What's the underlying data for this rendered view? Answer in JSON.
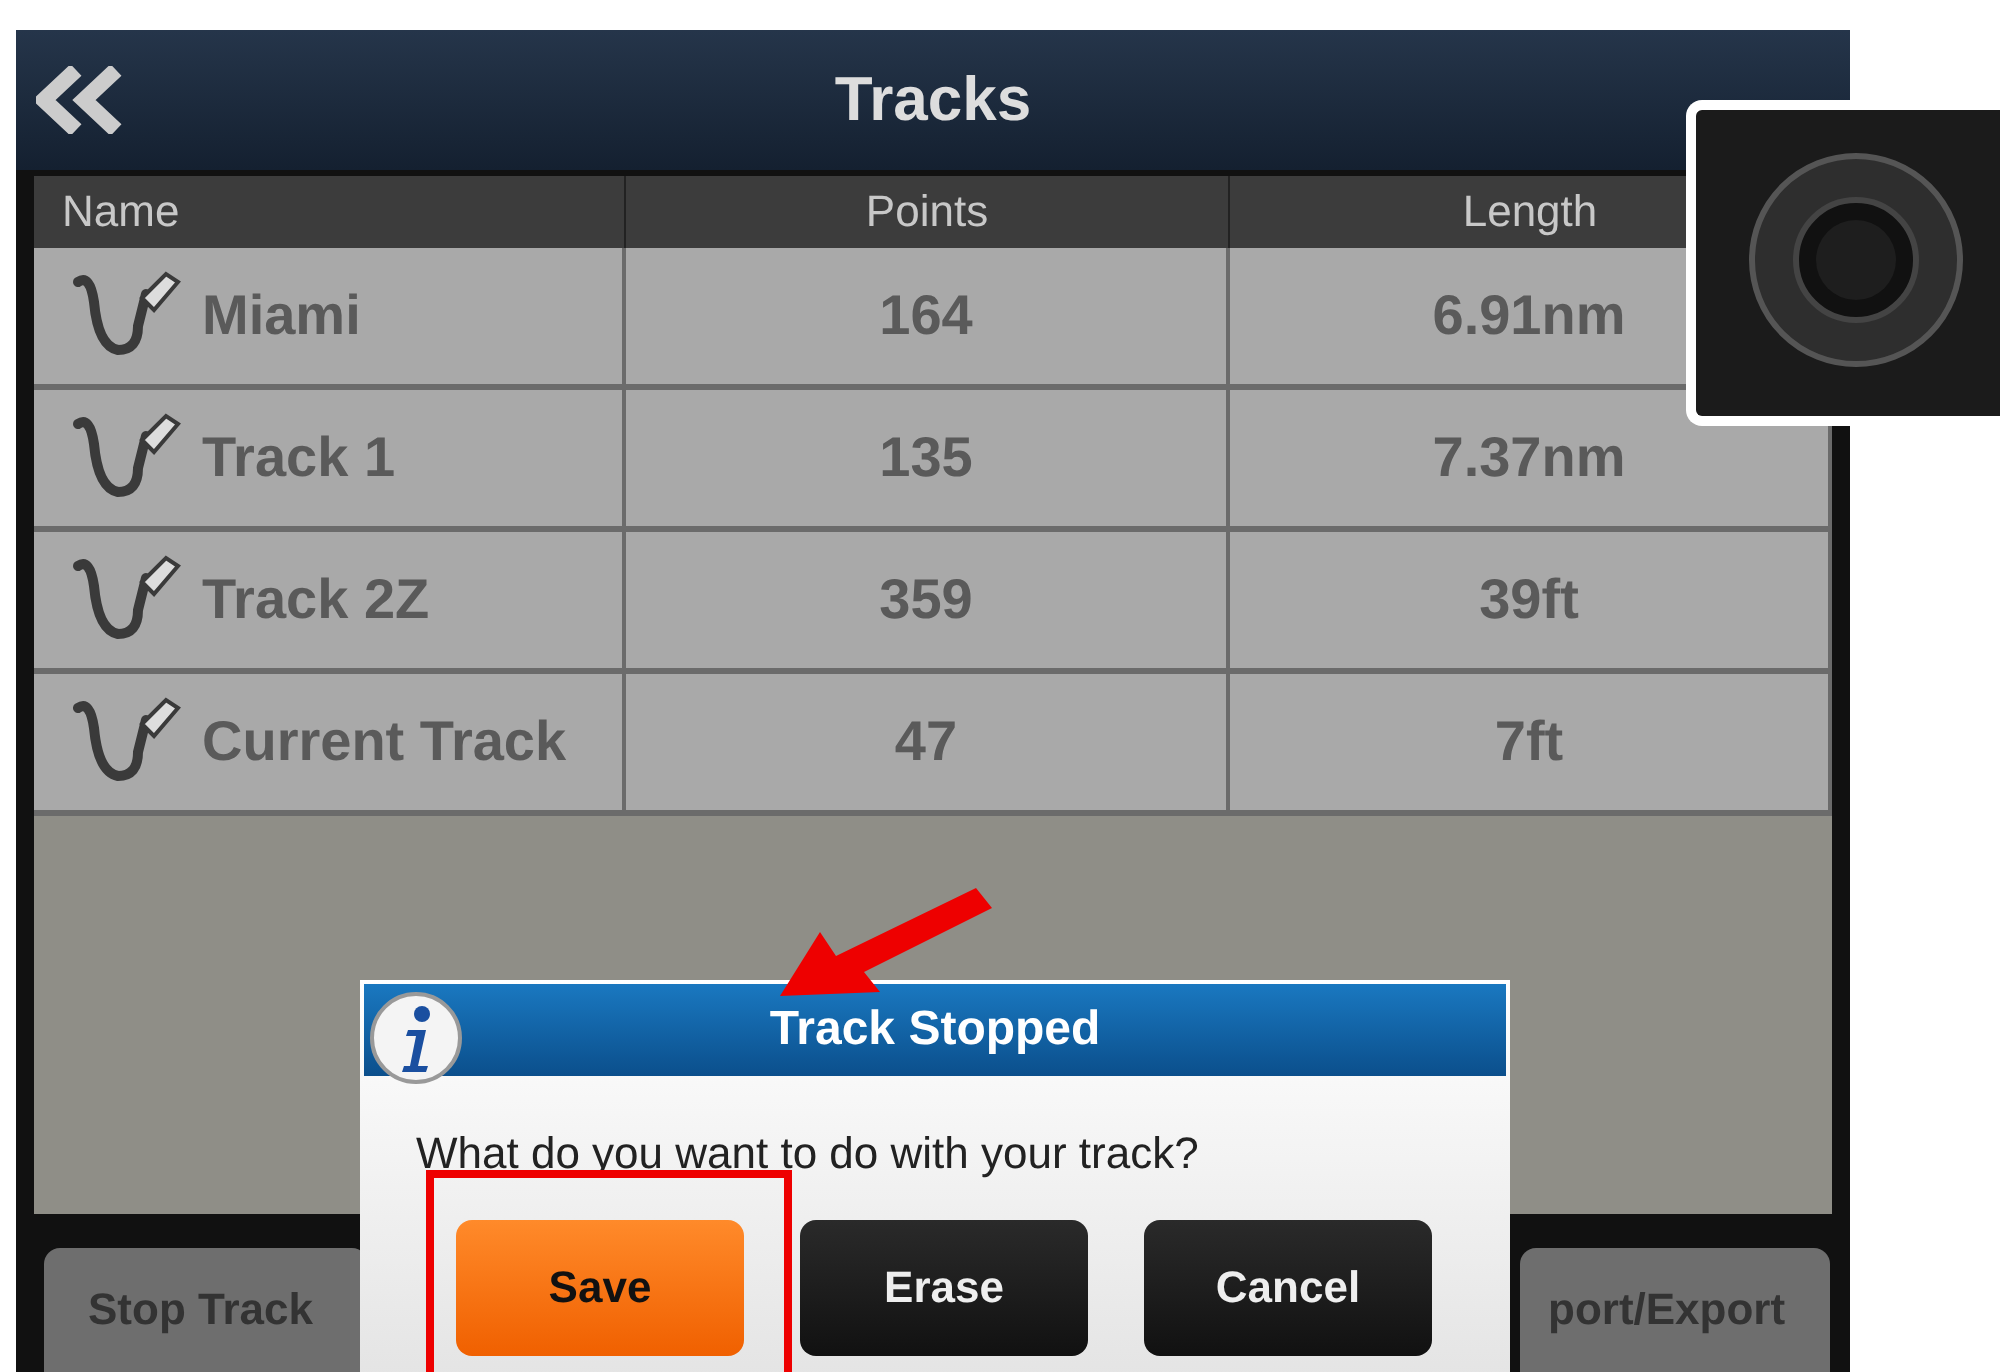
{
  "header": {
    "title": "Tracks"
  },
  "table": {
    "columns": [
      "Name",
      "Points",
      "Length"
    ],
    "rows": [
      {
        "name": "Miami",
        "points": "164",
        "length": "6.91nm"
      },
      {
        "name": "Track 1",
        "points": "135",
        "length": "7.37nm"
      },
      {
        "name": "Track 2Z",
        "points": "359",
        "length": "39ft"
      },
      {
        "name": "Current Track",
        "points": "47",
        "length": "7ft"
      }
    ]
  },
  "bottom_bar": {
    "buttons": [
      "Stop Track",
      "port/Export"
    ]
  },
  "dialog": {
    "title": "Track Stopped",
    "message": "What do you want to do with your track?",
    "buttons": [
      {
        "label": "Save",
        "kind": "primary"
      },
      {
        "label": "Erase",
        "kind": "normal"
      },
      {
        "label": "Cancel",
        "kind": "normal"
      }
    ]
  }
}
